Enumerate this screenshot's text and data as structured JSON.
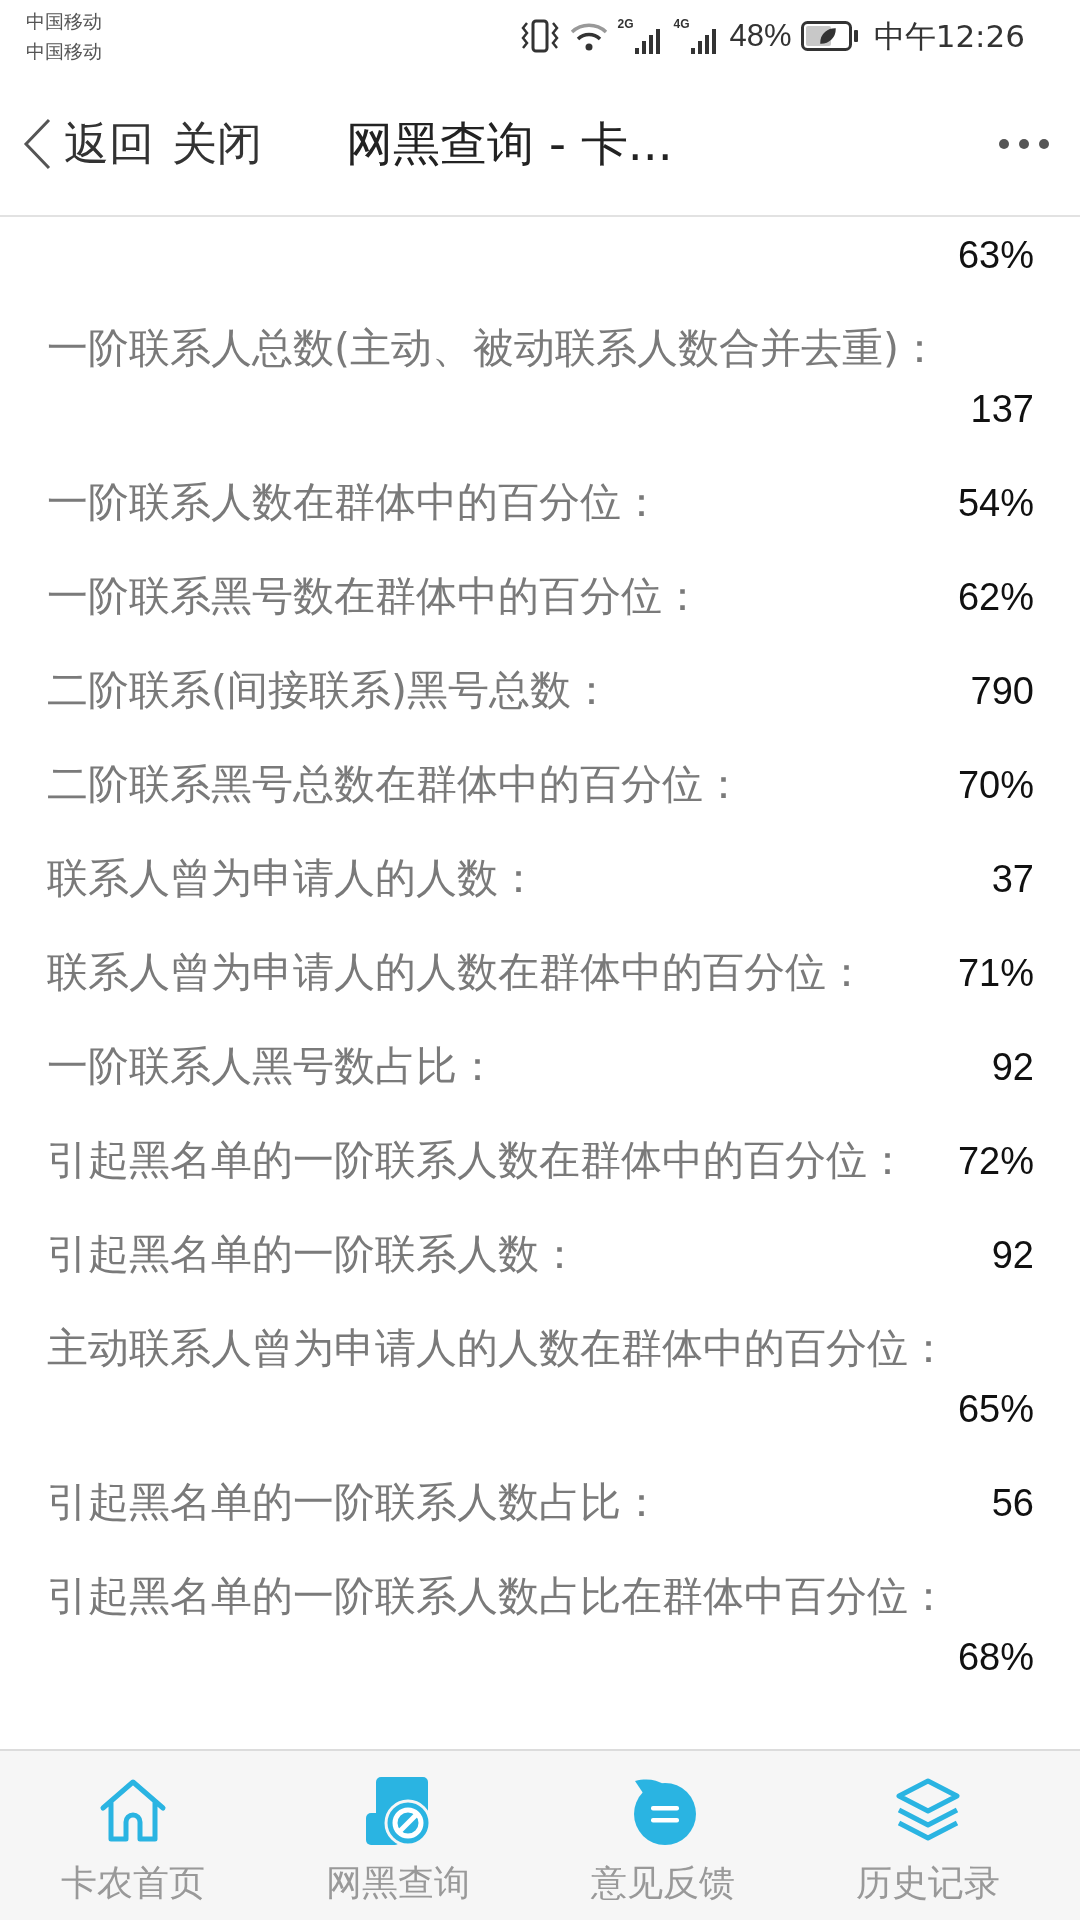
{
  "status_bar": {
    "carriers": [
      "中国移动",
      "中国移动"
    ],
    "network_labels": [
      "2G",
      "4G"
    ],
    "battery": "48%",
    "time": "中午12:26"
  },
  "header": {
    "back": "返回",
    "close": "关闭",
    "title": "网黑查询 - 卡..."
  },
  "rows": [
    {
      "kind": "stacked",
      "value": "63%"
    },
    {
      "kind": "stacked",
      "label": "一阶联系人总数(主动、被动联系人数合并去重)：",
      "value": "137"
    },
    {
      "kind": "inline",
      "label": "一阶联系人数在群体中的百分位：",
      "value": "54%"
    },
    {
      "kind": "inline",
      "label": "一阶联系黑号数在群体中的百分位：",
      "value": "62%"
    },
    {
      "kind": "inline",
      "label": "二阶联系(间接联系)黑号总数：",
      "value": "790"
    },
    {
      "kind": "inline",
      "label": "二阶联系黑号总数在群体中的百分位：",
      "value": "70%"
    },
    {
      "kind": "inline",
      "label": "联系人曾为申请人的人数：",
      "value": "37"
    },
    {
      "kind": "inline",
      "label": "联系人曾为申请人的人数在群体中的百分位：",
      "value": "71%"
    },
    {
      "kind": "inline",
      "label": "一阶联系人黑号数占比：",
      "value": "92"
    },
    {
      "kind": "inline",
      "label": "引起黑名单的一阶联系人数在群体中的百分位：",
      "value": "72%"
    },
    {
      "kind": "inline",
      "label": "引起黑名单的一阶联系人数：",
      "value": "92"
    },
    {
      "kind": "stacked",
      "label": "主动联系人曾为申请人的人数在群体中的百分位：",
      "value": "65%"
    },
    {
      "kind": "inline",
      "label": "引起黑名单的一阶联系人数占比：",
      "value": "56"
    },
    {
      "kind": "stacked",
      "label": "引起黑名单的一阶联系人数占比在群体中百分位：",
      "value": "68%"
    }
  ],
  "tab_bar": {
    "tabs": [
      {
        "label": "卡农首页"
      },
      {
        "label": "网黑查询"
      },
      {
        "label": "意见反馈"
      },
      {
        "label": "历史记录"
      }
    ]
  }
}
